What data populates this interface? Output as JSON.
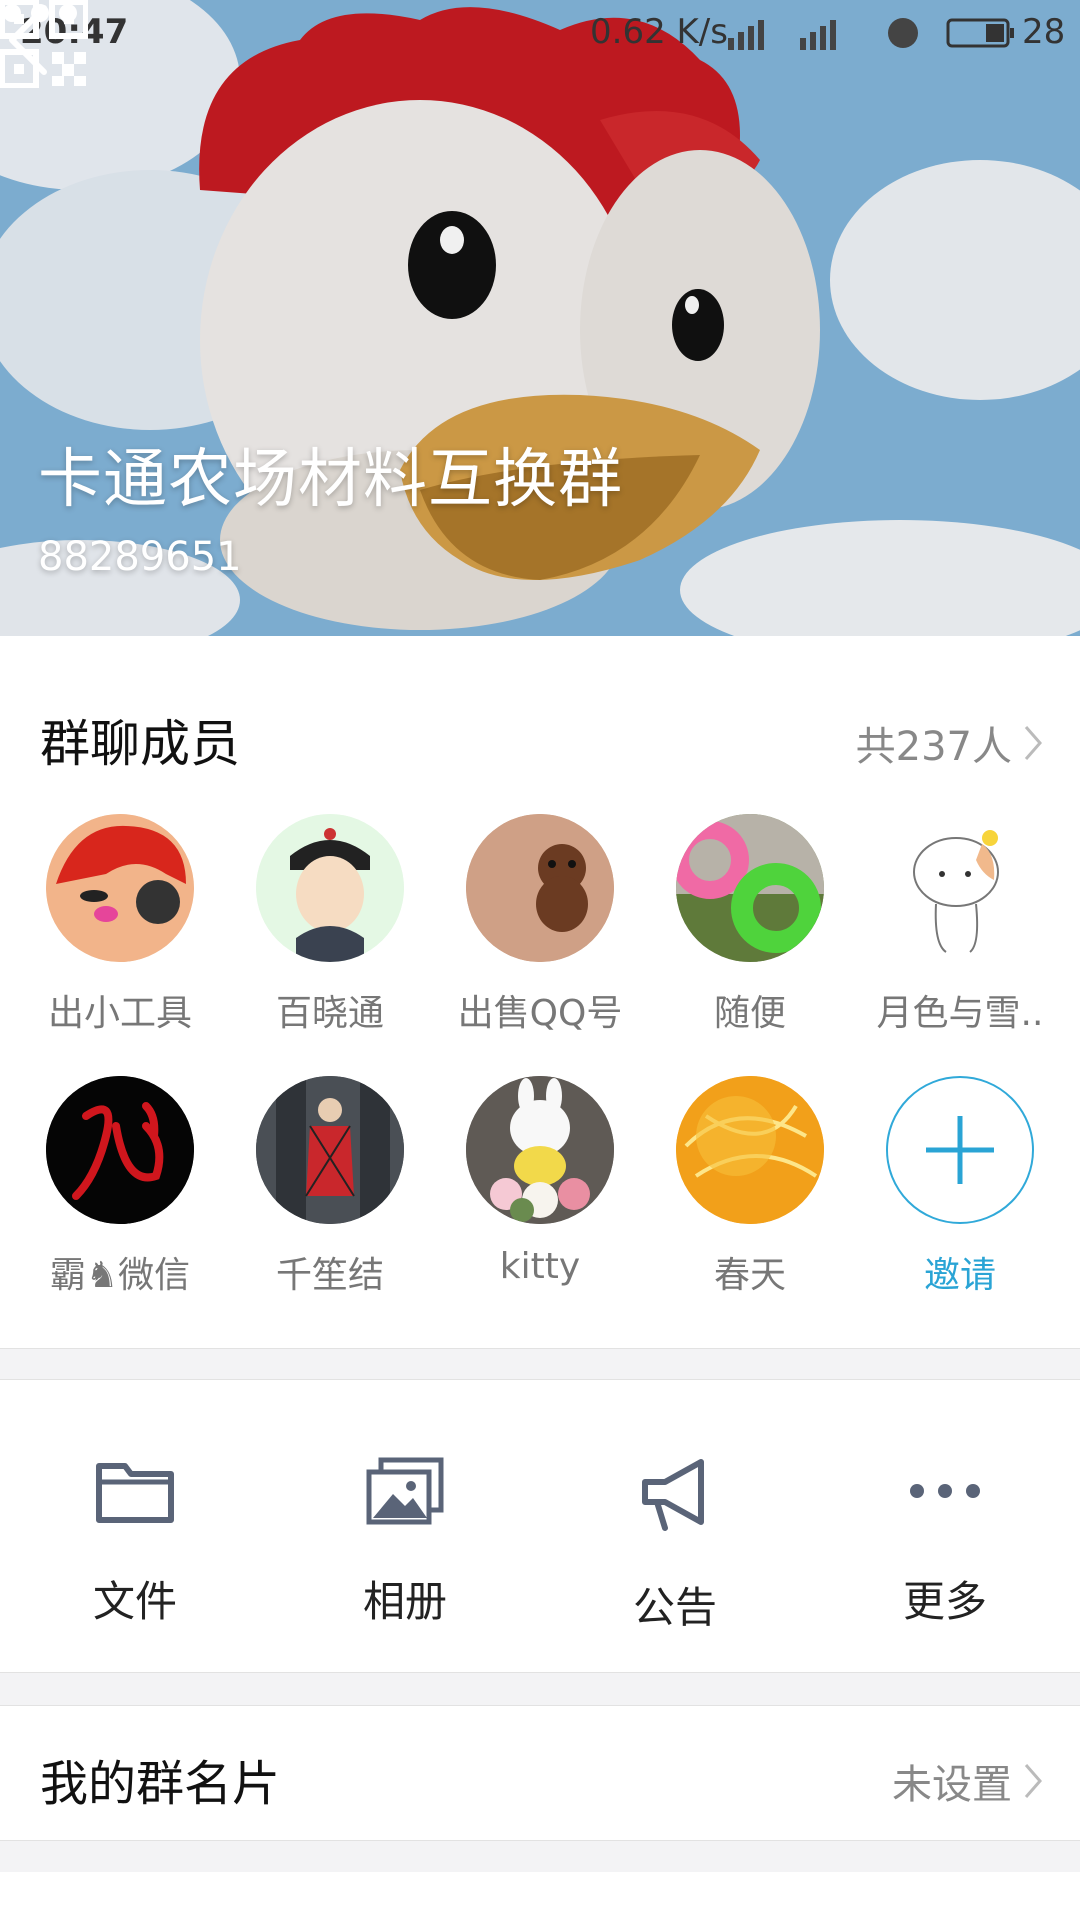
{
  "status_bar": {
    "time": "20:47",
    "network_speed": "0.62 K/s",
    "battery": "28"
  },
  "header": {
    "group_name": "卡通农场材料互换群",
    "group_id": "88289651"
  },
  "members_section": {
    "title": "群聊成员",
    "count_label": "共237人",
    "members": [
      {
        "name": "出小工具"
      },
      {
        "name": "百晓通"
      },
      {
        "name": "出售QQ号"
      },
      {
        "name": "随便"
      },
      {
        "name": "月色与雪.."
      },
      {
        "name": "霸♞微信"
      },
      {
        "name": "千笙结"
      },
      {
        "name": "kitty"
      },
      {
        "name": "春天"
      }
    ],
    "invite_label": "邀请"
  },
  "tools": [
    {
      "label": "文件",
      "icon": "folder-icon"
    },
    {
      "label": "相册",
      "icon": "album-icon"
    },
    {
      "label": "公告",
      "icon": "announcement-icon"
    },
    {
      "label": "更多",
      "icon": "more-icon"
    }
  ],
  "my_card": {
    "label": "我的群名片",
    "value": "未设置"
  },
  "colors": {
    "accent": "#2aa4d5",
    "icon_gray": "#5a6478"
  }
}
